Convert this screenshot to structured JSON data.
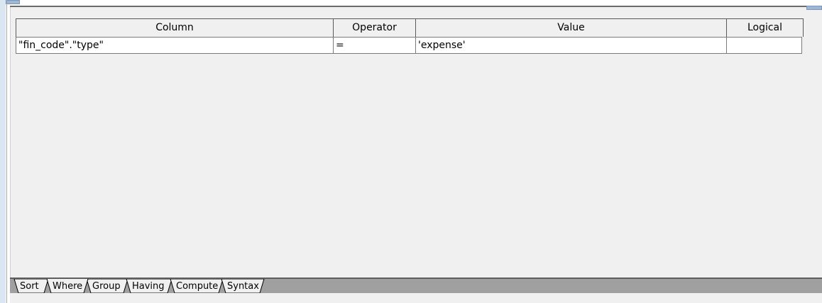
{
  "grid": {
    "headers": {
      "column": "Column",
      "operator": "Operator",
      "value": "Value",
      "logical": "Logical"
    },
    "rows": [
      {
        "column": "\"fin_code\".\"type\"",
        "operator": "=",
        "value": "'expense'",
        "logical": ""
      }
    ]
  },
  "tabs": [
    {
      "label": "Sort",
      "active": false
    },
    {
      "label": "Where",
      "active": true
    },
    {
      "label": "Group",
      "active": false
    },
    {
      "label": "Having",
      "active": false
    },
    {
      "label": "Compute",
      "active": false
    },
    {
      "label": "Syntax",
      "active": false
    }
  ],
  "colors": {
    "panel_bg": "#f0f0f0",
    "tabbar_bg": "#a0a0a0",
    "active_tab_bg": "#f0f0f0",
    "accent_strip": "#dbe6f3"
  }
}
